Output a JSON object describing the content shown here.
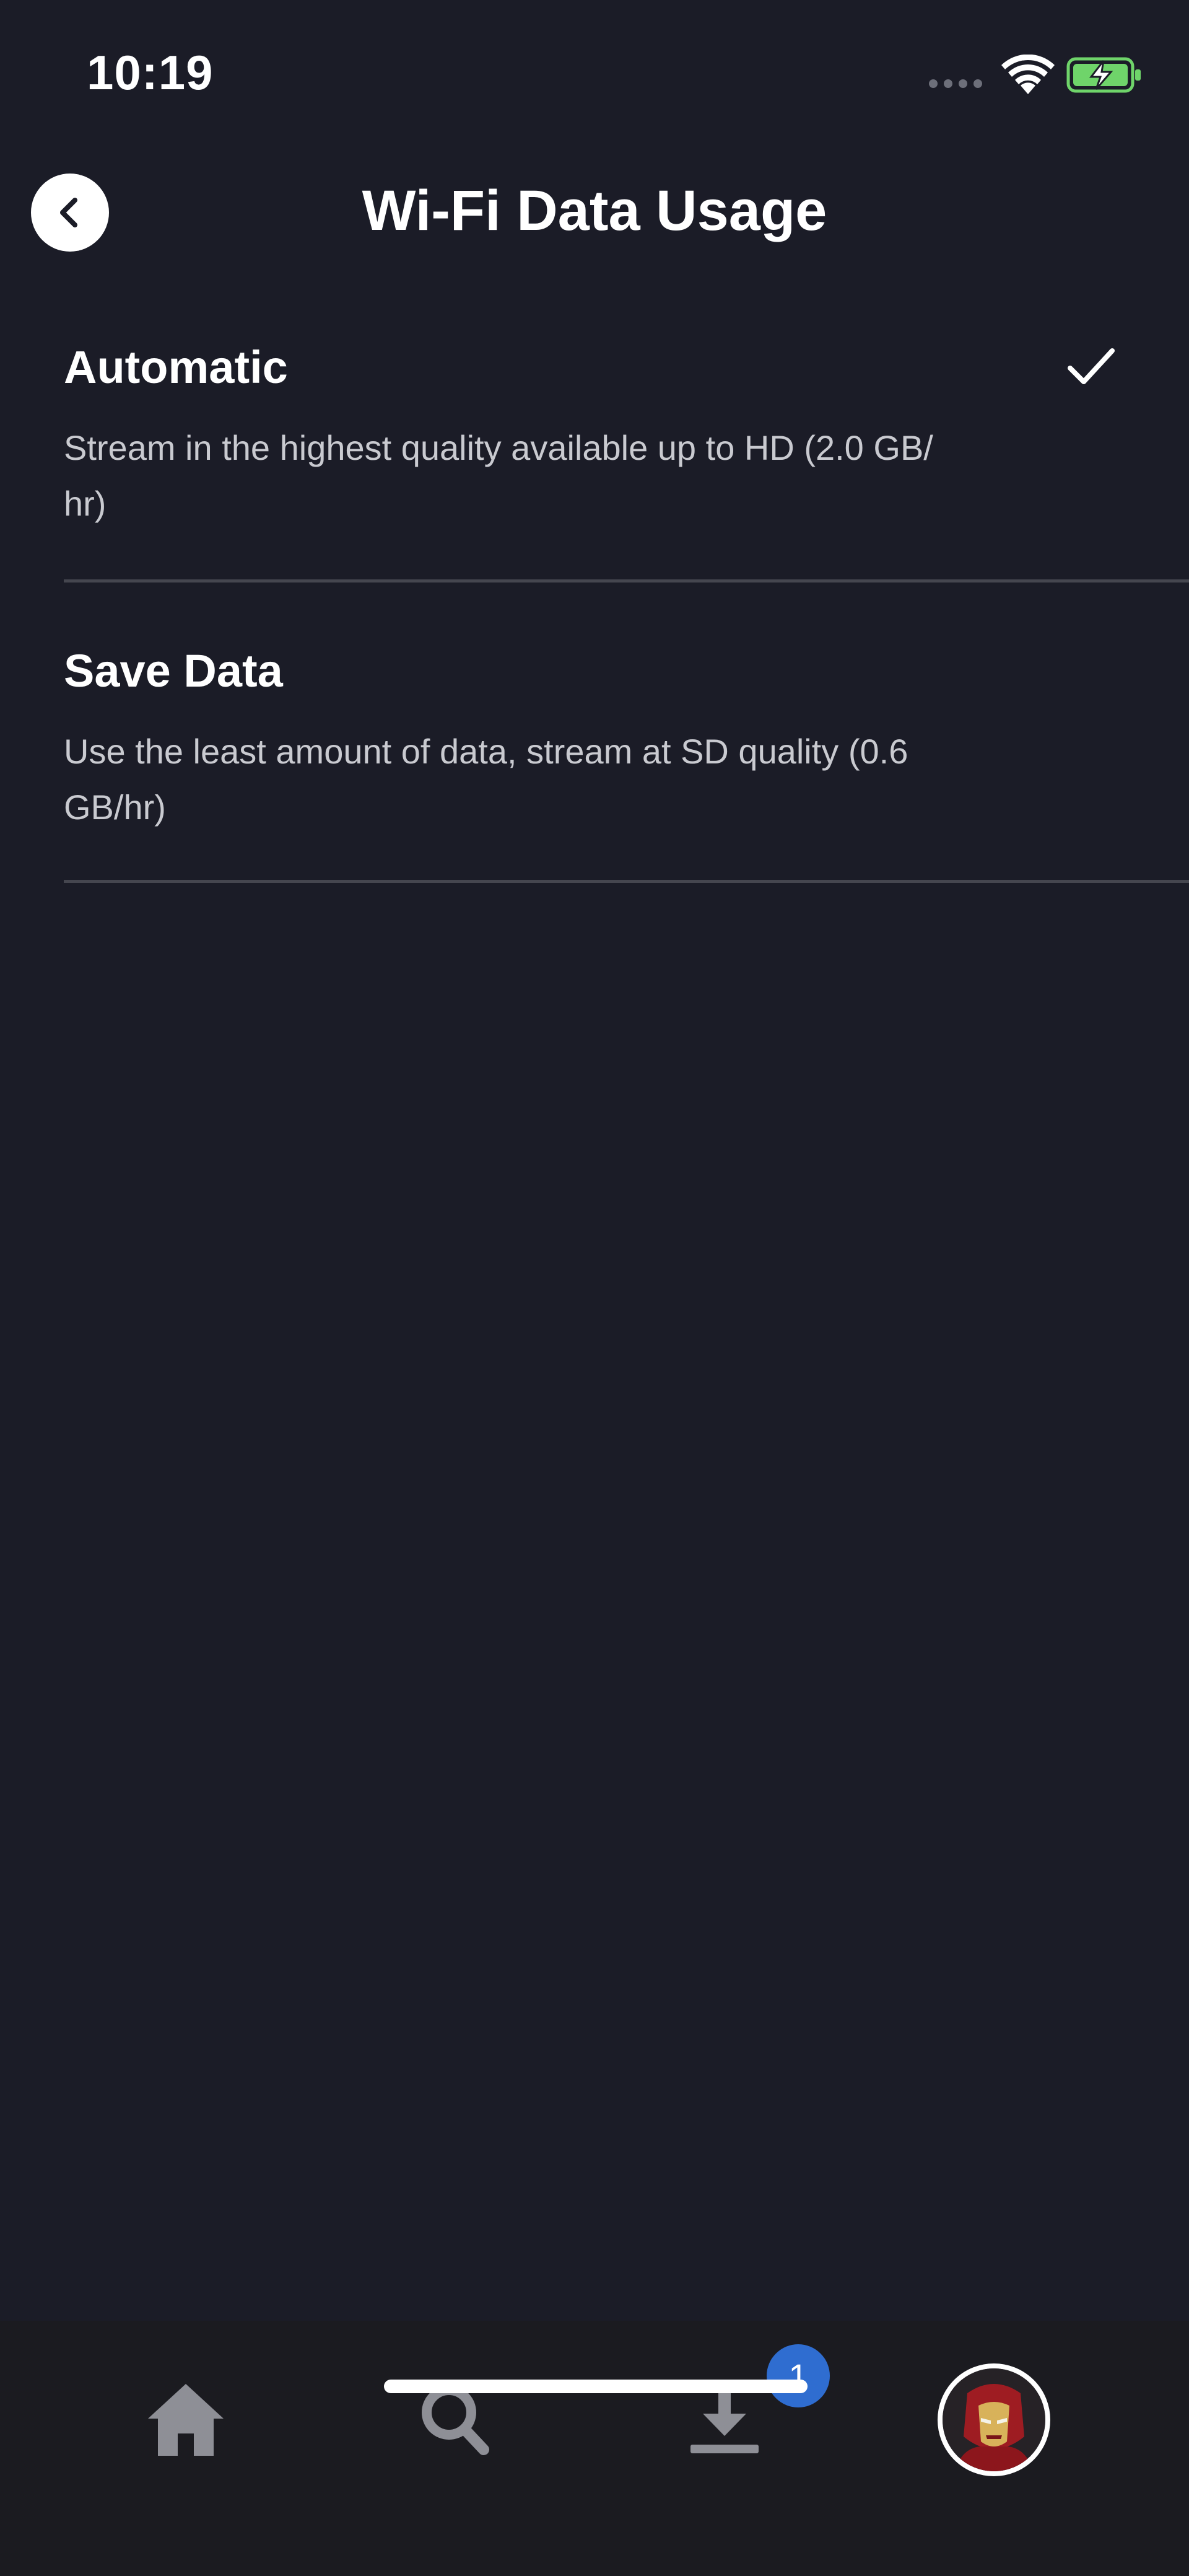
{
  "status_bar": {
    "time": "10:19"
  },
  "header": {
    "title": "Wi-Fi Data Usage"
  },
  "options": [
    {
      "title": "Automatic",
      "description": "Stream in the highest quality available up to HD (2.0 GB/\nhr)",
      "selected": true
    },
    {
      "title": "Save Data",
      "description": "Use the least amount of data, stream at SD quality (0.6\nGB/hr)",
      "selected": false
    }
  ],
  "tab_bar": {
    "downloads_badge": "1"
  },
  "colors": {
    "background": "#1b1c27",
    "tab_bar": "#1b1b20",
    "divider": "#45464f",
    "badge": "#2f6dd0",
    "battery": "#6fd46a"
  },
  "icons": [
    "back-arrow-icon",
    "checkmark-icon",
    "home-icon",
    "search-icon",
    "download-icon",
    "avatar"
  ]
}
